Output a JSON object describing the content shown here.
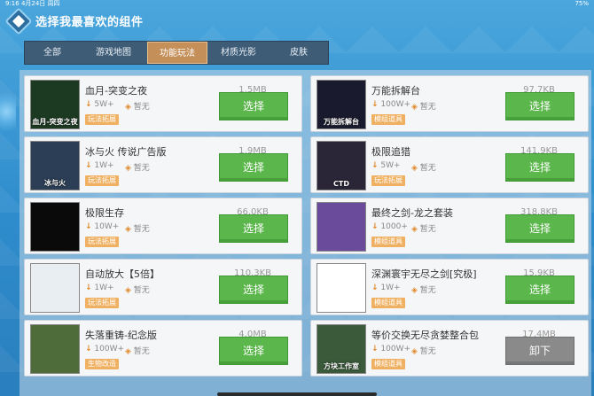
{
  "statusbar": {
    "left": "9:16  4月24日 周四",
    "right": "75%"
  },
  "header": {
    "title": "选择我最喜欢的组件"
  },
  "tabs": [
    {
      "label": "全部",
      "active": false
    },
    {
      "label": "游戏地图",
      "active": false
    },
    {
      "label": "功能玩法",
      "active": true
    },
    {
      "label": "材质光影",
      "active": false
    },
    {
      "label": "皮肤",
      "active": false
    }
  ],
  "items": [
    {
      "name": "血月-突变之夜",
      "size": "1.5MB",
      "downloads": "5W+",
      "price": "暂无",
      "badge": "玩法拓展",
      "action": "选择",
      "thumb_text": "血月-突变之夜",
      "thumb_color": "#1c3a22"
    },
    {
      "name": "万能拆解台",
      "size": "97.7KB",
      "downloads": "100W+",
      "price": "暂无",
      "badge": "模组道具",
      "action": "选择",
      "thumb_text": "万能拆解台",
      "thumb_color": "#1a1a2e"
    },
    {
      "name": "冰与火 传说广告版",
      "size": "1.9MB",
      "downloads": "1W+",
      "price": "暂无",
      "badge": "玩法拓展",
      "action": "选择",
      "thumb_text": "冰与火",
      "thumb_color": "#2c3e55"
    },
    {
      "name": "极限追猎",
      "size": "141.9KB",
      "downloads": "5W+",
      "price": "暂无",
      "badge": "玩法拓展",
      "action": "选择",
      "thumb_text": "CTD",
      "thumb_color": "#2a2638"
    },
    {
      "name": "极限生存",
      "size": "66.0KB",
      "downloads": "10W+",
      "price": "暂无",
      "badge": "玩法拓展",
      "action": "选择",
      "thumb_text": "",
      "thumb_color": "#0a0a0a"
    },
    {
      "name": "最终之剑-龙之套装",
      "size": "318.8KB",
      "downloads": "1000+",
      "price": "暂无",
      "badge": "模组道具",
      "action": "选择",
      "thumb_text": "",
      "thumb_color": "#6a4a9a"
    },
    {
      "name": "自动放大【5倍】",
      "size": "110.3KB",
      "downloads": "1W+",
      "price": "暂无",
      "badge": "玩法拓展",
      "action": "选择",
      "thumb_text": "",
      "thumb_color": "#e8eef2"
    },
    {
      "name": "深渊寰宇无尽之剑[究极]",
      "size": "15.9KB",
      "downloads": "1W+",
      "price": "暂无",
      "badge": "模组道具",
      "action": "选择",
      "thumb_text": "",
      "thumb_color": "#ffffff"
    },
    {
      "name": "失落重铸-纪念版",
      "size": "4.0MB",
      "downloads": "100W+",
      "price": "暂无",
      "badge": "生物改造",
      "action": "选择",
      "thumb_text": "",
      "thumb_color": "#4e6b3a"
    },
    {
      "name": "等价交换无尽贪婪整合包",
      "size": "17.4MB",
      "downloads": "100W+",
      "price": "暂无",
      "badge": "模组道具",
      "action": "卸下",
      "thumb_text": "方块工作室",
      "thumb_color": "#3a5a3a"
    }
  ],
  "colors": {
    "accent_green": "#5bb64b",
    "tab_active": "#c58f5a",
    "badge_orange": "#f0b062",
    "uninstall_gray": "#8a8a8a"
  }
}
